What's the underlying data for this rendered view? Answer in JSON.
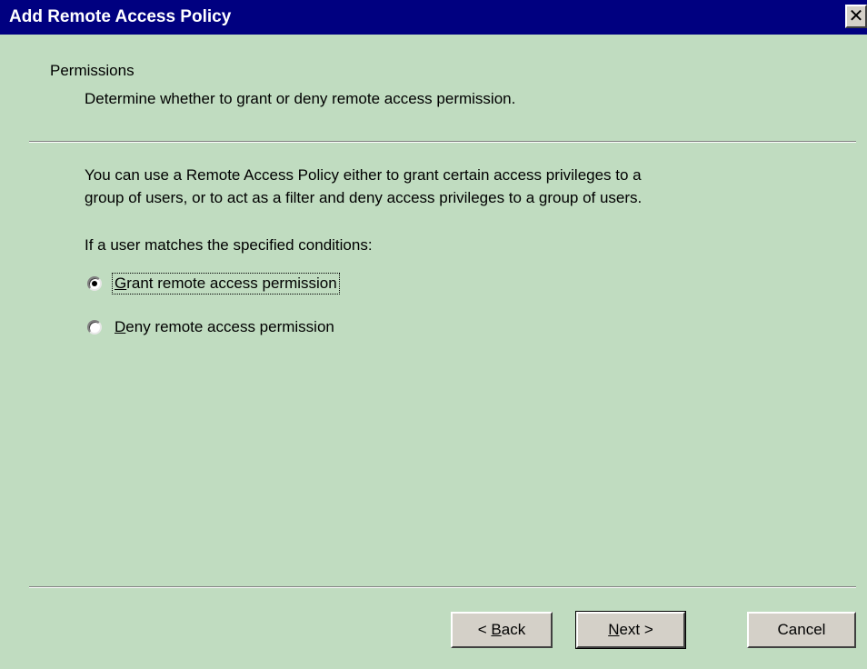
{
  "window": {
    "title": "Add Remote Access Policy",
    "close_glyph": "✕"
  },
  "header": {
    "title": "Permissions",
    "subtitle": "Determine whether to grant or deny remote access permission."
  },
  "body": {
    "description_line1": "You can use a Remote Access Policy either to grant certain access privileges to a",
    "description_line2": "group of users, or to act as a filter and deny access privileges to a group of users.",
    "condition_label": "If a user matches the specified conditions:"
  },
  "options": {
    "grant": {
      "mnemonic": "G",
      "rest": "rant remote access permission",
      "selected": true
    },
    "deny": {
      "mnemonic": "D",
      "rest": "eny remote access permission",
      "selected": false
    }
  },
  "buttons": {
    "back_prefix": "< ",
    "back_mnemonic": "B",
    "back_rest": "ack",
    "next_mnemonic": "N",
    "next_rest": "ext >",
    "cancel": "Cancel"
  },
  "colors": {
    "titlebar": "#000080",
    "background": "#c0dcc0",
    "button_face": "#d4d0c8"
  }
}
